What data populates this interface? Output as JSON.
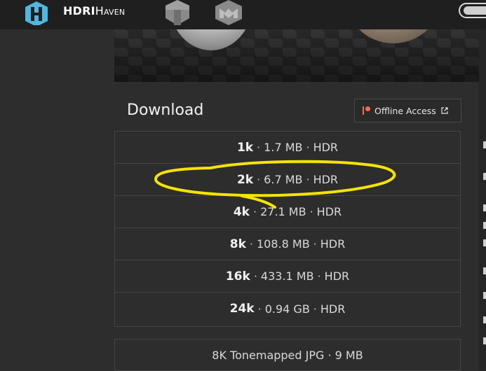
{
  "header": {
    "brand_bold": "HDRI",
    "brand_rest": "Haven",
    "icons": [
      "hdrihaven-logo-icon",
      "texture-haven-icon",
      "3d-model-haven-icon"
    ]
  },
  "download": {
    "title": "Download",
    "offline_label": "Offline Access",
    "rows": [
      {
        "res": "1k",
        "size": "1.7 MB",
        "format": "HDR"
      },
      {
        "res": "2k",
        "size": "6.7 MB",
        "format": "HDR"
      },
      {
        "res": "4k",
        "size": "27.1 MB",
        "format": "HDR"
      },
      {
        "res": "8k",
        "size": "108.8 MB",
        "format": "HDR"
      },
      {
        "res": "16k",
        "size": "433.1 MB",
        "format": "HDR"
      },
      {
        "res": "24k",
        "size": "0.94 GB",
        "format": "HDR"
      }
    ],
    "separator": "·",
    "tonemapped_label": "8K Tonemapped JPG · 9 MB"
  },
  "annotation": {
    "color": "#f5e400",
    "circled_row": "2k"
  },
  "colors": {
    "accent": "#4fb8e0",
    "patreon": "#f96854"
  }
}
